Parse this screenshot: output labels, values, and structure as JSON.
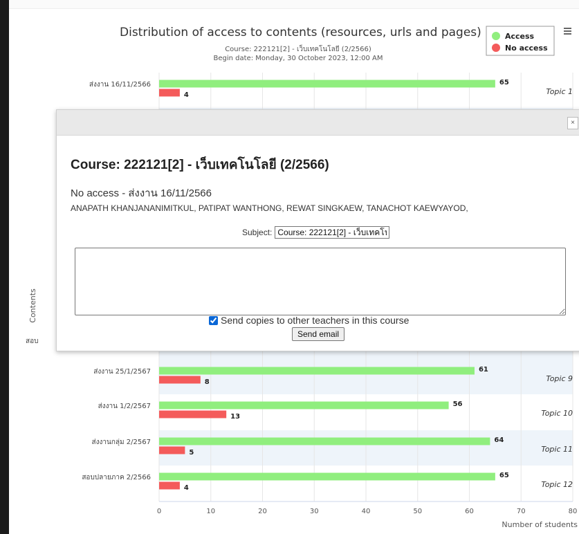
{
  "chart_data": {
    "type": "bar",
    "title": "Distribution of access to contents (resources, urls and pages)",
    "subtitle_course": "Course: 222121[2] - เว็บเทคโนโลยี (2/2566)",
    "subtitle_date": "Begin date: Monday, 30 October 2023, 12:00 AM",
    "ylabel": "Contents",
    "xlabel": "Number of students",
    "xlim": [
      0,
      80
    ],
    "xticks": [
      "0",
      "10",
      "20",
      "30",
      "40",
      "50",
      "60",
      "70",
      "80"
    ],
    "legend_position": "top-right",
    "categories": [
      "ส่งงาน 16/11/2566",
      "ส่งงาน 25/1/2567",
      "ส่งงาน 1/2/2567",
      "ส่งงานกลุ่ม 2/2567",
      "สอบปลายภาค 2/2566"
    ],
    "topics": [
      "Topic 1",
      "Topic 9",
      "Topic 10",
      "Topic 11",
      "Topic 12"
    ],
    "series": [
      {
        "name": "Access",
        "color": "#90ee7e",
        "values": [
          65,
          61,
          56,
          64,
          65
        ]
      },
      {
        "name": "No access",
        "color": "#f45b5b",
        "values": [
          4,
          8,
          13,
          5,
          4
        ]
      }
    ],
    "hidden_partial_label": "สอบ",
    "grid": true
  },
  "menu_icon": "hamburger-menu-icon",
  "modal": {
    "close_symbol": "×",
    "course": "Course: 222121[2] - เว็บเทคโนโลยี (2/2566)",
    "no_access": "No access - ส่งงาน 16/11/2566",
    "students": "ANAPATH KHANJANANIMITKUL, PATIPAT WANTHONG, REWAT SINGKAEW, TANACHOT KAEWYAYOD,",
    "subject_label": "Subject:",
    "subject_value": "Course: 222121[2] - เว็บเทคโนโลยี (2/2566)",
    "message_value": "",
    "copies_label": "Send copies to other teachers in this course",
    "copies_checked": true,
    "send_label": "Send email"
  }
}
